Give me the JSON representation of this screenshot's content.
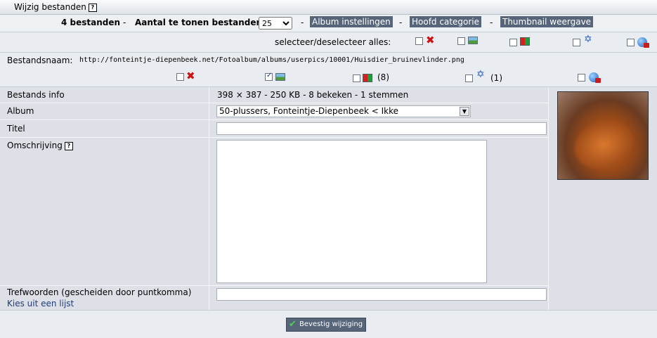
{
  "header": {
    "title": "Wijzig bestanden",
    "help": "?"
  },
  "toolbar": {
    "count_label": "4 bestanden",
    "show_label": "Aantal te tonen bestanden",
    "per_page": "25",
    "sep": "-",
    "album_settings": "Album instellingen",
    "main_category": "Hoofd categorie",
    "thumbnail_view": "Thumbnail weergave"
  },
  "select_all": {
    "label": "selecteer/deselecteer alles:"
  },
  "file": {
    "name_label": "Bestandsnaam:",
    "name_value": "http://fonteintje-diepenbeek.net/Fotoalbum/albums/userpics/10001/Huisdier_bruinevlinder.png",
    "flag_count": "(8)",
    "star_count": "(1)"
  },
  "form": {
    "info_label": "Bestands info",
    "info_value": "398 × 387 - 250 KB - 8 bekeken - 1 stemmen",
    "album_label": "Album",
    "album_value": "50-plussers, Fonteintje-Diepenbeek < Ikke",
    "title_label": "Titel",
    "title_value": "",
    "description_label": "Omschrijving",
    "description_help": "?",
    "description_value": "",
    "keywords_label": "Trefwoorden (gescheiden door puntkomma)",
    "keywords_link": "Kies uit een lijst",
    "keywords_value": ""
  },
  "footer": {
    "submit_label": "Bevestig wijziging"
  },
  "icons": [
    "delete-icon",
    "image-icon",
    "flag-icon",
    "star-icon",
    "globe-delete-icon",
    "checkmark-icon",
    "help-icon"
  ]
}
